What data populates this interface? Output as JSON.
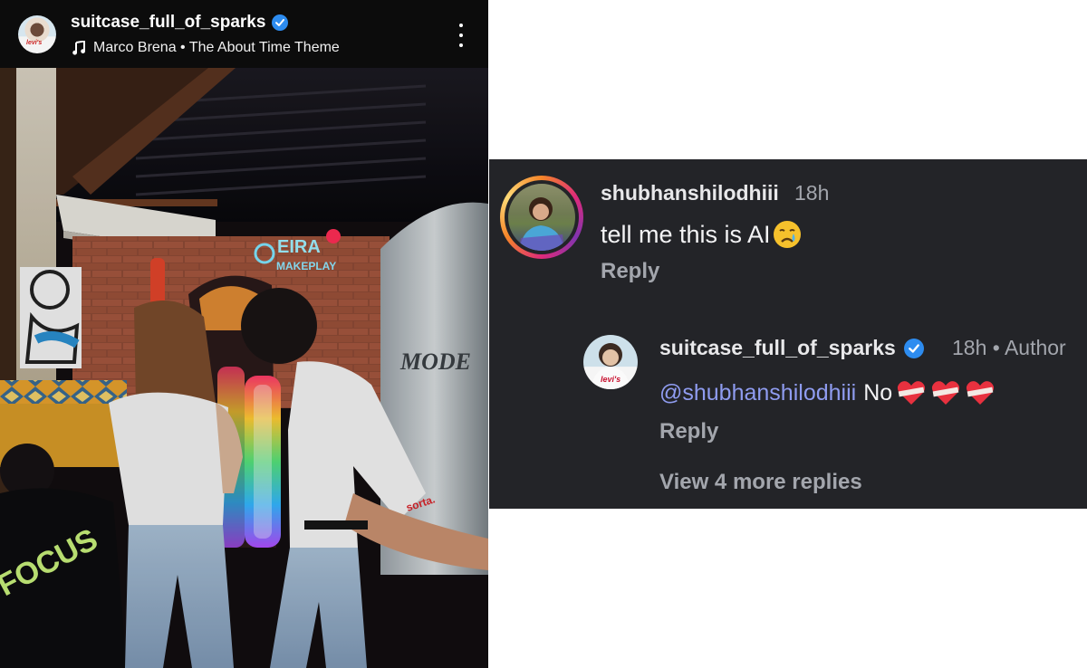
{
  "post": {
    "username": "suitcase_full_of_sparks",
    "audio": "Marco Brena • The About Time Theme",
    "avatar_badge": "levi's",
    "photo_texts": {
      "neon_sign": "EIRA",
      "neon_sub": "MAKEPLAY",
      "shirt_print": "FOCUS",
      "tshirt_tag": "sorta.",
      "jukebox_sign": "MODE"
    }
  },
  "comments": {
    "comment": {
      "username": "shubhanshilodhiii",
      "time": "18h",
      "text": "tell me this is AI",
      "reply_label": "Reply"
    },
    "reply": {
      "username": "suitcase_full_of_sparks",
      "time": "18h • Author",
      "mention": "@shubhanshilodhiii",
      "text": "No",
      "reply_label": "Reply",
      "avatar_badge": "levi's"
    },
    "view_more": "View 4 more replies"
  },
  "colors": {
    "verified": "#2d8cf0",
    "mention": "#8f9cf0",
    "comment_bg": "#232428",
    "secondary_text": "#a3a6ad"
  }
}
